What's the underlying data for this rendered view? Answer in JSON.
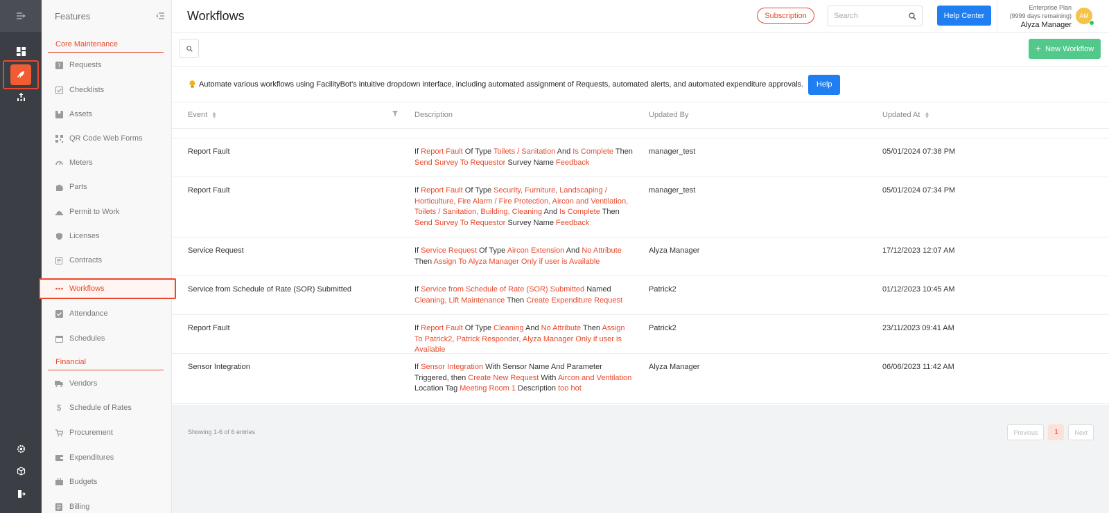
{
  "features_title": "Features",
  "sections": {
    "core": "Core Maintenance",
    "financial": "Financial"
  },
  "nav_core": [
    {
      "label": "Requests",
      "icon": "question-icon"
    },
    {
      "label": "Checklists",
      "icon": "checklist-icon"
    },
    {
      "label": "Assets",
      "icon": "box-icon"
    },
    {
      "label": "QR Code Web Forms",
      "icon": "qr-icon"
    },
    {
      "label": "Meters",
      "icon": "gauge-icon"
    },
    {
      "label": "Parts",
      "icon": "puzzle-icon"
    },
    {
      "label": "Permit to Work",
      "icon": "hardhat-icon"
    },
    {
      "label": "Licenses",
      "icon": "shield-icon"
    },
    {
      "label": "Contracts",
      "icon": "document-icon"
    },
    {
      "label": "Workflows",
      "icon": "dots-icon"
    },
    {
      "label": "Attendance",
      "icon": "check-square-icon"
    },
    {
      "label": "Schedules",
      "icon": "calendar-icon"
    }
  ],
  "nav_financial": [
    {
      "label": "Vendors",
      "icon": "truck-icon"
    },
    {
      "label": "Schedule of Rates",
      "icon": "dollar-icon"
    },
    {
      "label": "Procurement",
      "icon": "cart-icon"
    },
    {
      "label": "Expenditures",
      "icon": "wallet-icon"
    },
    {
      "label": "Budgets",
      "icon": "briefcase-icon"
    },
    {
      "label": "Billing",
      "icon": "bill-icon"
    }
  ],
  "header": {
    "title": "Workflows",
    "subscription": "Subscription",
    "search_placeholder": "Search",
    "help_center": "Help Center",
    "plan": "Enterprise Plan",
    "plan_days": "(9999 days remaining)",
    "user": "Alyza Manager",
    "avatar": "AM"
  },
  "toolbar": {
    "new_workflow": "New Workflow"
  },
  "banner": {
    "text": "Automate various workflows using FacilityBot's intuitive dropdown interface, including automated assignment of Requests, automated alerts, and automated expenditure approvals.",
    "help": "Help"
  },
  "table": {
    "columns": [
      "Event",
      "Description",
      "Updated By",
      "Updated At"
    ],
    "rows": [
      {
        "event": "Report Fault",
        "description": [
          [
            "If ",
            false
          ],
          [
            "Report Fault",
            true
          ],
          [
            " Of Type ",
            false
          ],
          [
            "Toilets / Sanitation",
            true
          ],
          [
            " And ",
            false
          ],
          [
            "Is Complete",
            true
          ],
          [
            " Then ",
            false
          ],
          [
            "Send Survey To Requestor",
            true
          ],
          [
            " Survey Name ",
            false
          ],
          [
            "Feedback",
            true
          ]
        ],
        "updated_by": "manager_test",
        "updated_at": "05/01/2024 07:38 PM"
      },
      {
        "event": "Report Fault",
        "description": [
          [
            "If ",
            false
          ],
          [
            "Report Fault",
            true
          ],
          [
            " Of Type ",
            false
          ],
          [
            "Security, Furniture, Landscaping / Horticulture, Fire Alarm / Fire Protection, Aircon and Ventilation, Toilets / Sanitation, Building, Cleaning",
            true
          ],
          [
            " And ",
            false
          ],
          [
            "Is Complete",
            true
          ],
          [
            " Then ",
            false
          ],
          [
            "Send Survey To Requestor",
            true
          ],
          [
            " Survey Name ",
            false
          ],
          [
            "Feedback",
            true
          ]
        ],
        "updated_by": "manager_test",
        "updated_at": "05/01/2024 07:34 PM"
      },
      {
        "event": "Service Request",
        "description": [
          [
            "If ",
            false
          ],
          [
            "Service Request",
            true
          ],
          [
            " Of Type ",
            false
          ],
          [
            "Aircon Extension",
            true
          ],
          [
            " And ",
            false
          ],
          [
            "No Attribute",
            true
          ],
          [
            " Then ",
            false
          ],
          [
            "Assign To Alyza Manager Only if user is Available",
            true
          ]
        ],
        "updated_by": "Alyza Manager",
        "updated_at": "17/12/2023 12:07 AM"
      },
      {
        "event": "Service from Schedule of Rate (SOR) Submitted",
        "description": [
          [
            "If ",
            false
          ],
          [
            "Service from Schedule of Rate (SOR) Submitted",
            true
          ],
          [
            " Named ",
            false
          ],
          [
            "Cleaning, Lift Maintenance",
            true
          ],
          [
            " Then ",
            false
          ],
          [
            "Create Expenditure Request",
            true
          ]
        ],
        "updated_by": "Patrick2",
        "updated_at": "01/12/2023 10:45 AM"
      },
      {
        "event": "Report Fault",
        "description": [
          [
            "If ",
            false
          ],
          [
            "Report Fault",
            true
          ],
          [
            " Of Type ",
            false
          ],
          [
            "Cleaning",
            true
          ],
          [
            " And ",
            false
          ],
          [
            "No Attribute",
            true
          ],
          [
            " Then ",
            false
          ],
          [
            "Assign To Patrick2, Patrick Responder, Alyza Manager Only if user is Available",
            true
          ]
        ],
        "updated_by": "Patrick2",
        "updated_at": "23/11/2023 09:41 AM"
      },
      {
        "event": "Sensor Integration",
        "description": [
          [
            "If ",
            false
          ],
          [
            "Sensor Integration",
            true
          ],
          [
            " With Sensor Name And Parameter Triggered, then ",
            false
          ],
          [
            "Create New Request",
            true
          ],
          [
            " With ",
            false
          ],
          [
            "Aircon and Ventilation",
            true
          ],
          [
            " Location Tag ",
            false
          ],
          [
            "Meeting Room 1",
            true
          ],
          [
            " Description ",
            false
          ],
          [
            "too hot",
            true
          ]
        ],
        "updated_by": "Alyza Manager",
        "updated_at": "06/06/2023 11:42 AM"
      }
    ]
  },
  "footer": {
    "showing": "Showing 1-6 of 6 entries",
    "previous": "Previous",
    "page": "1",
    "next": "Next"
  },
  "colors": {
    "accent": "#e8492c",
    "primary": "#1f7ef2",
    "success": "#52c98a"
  }
}
